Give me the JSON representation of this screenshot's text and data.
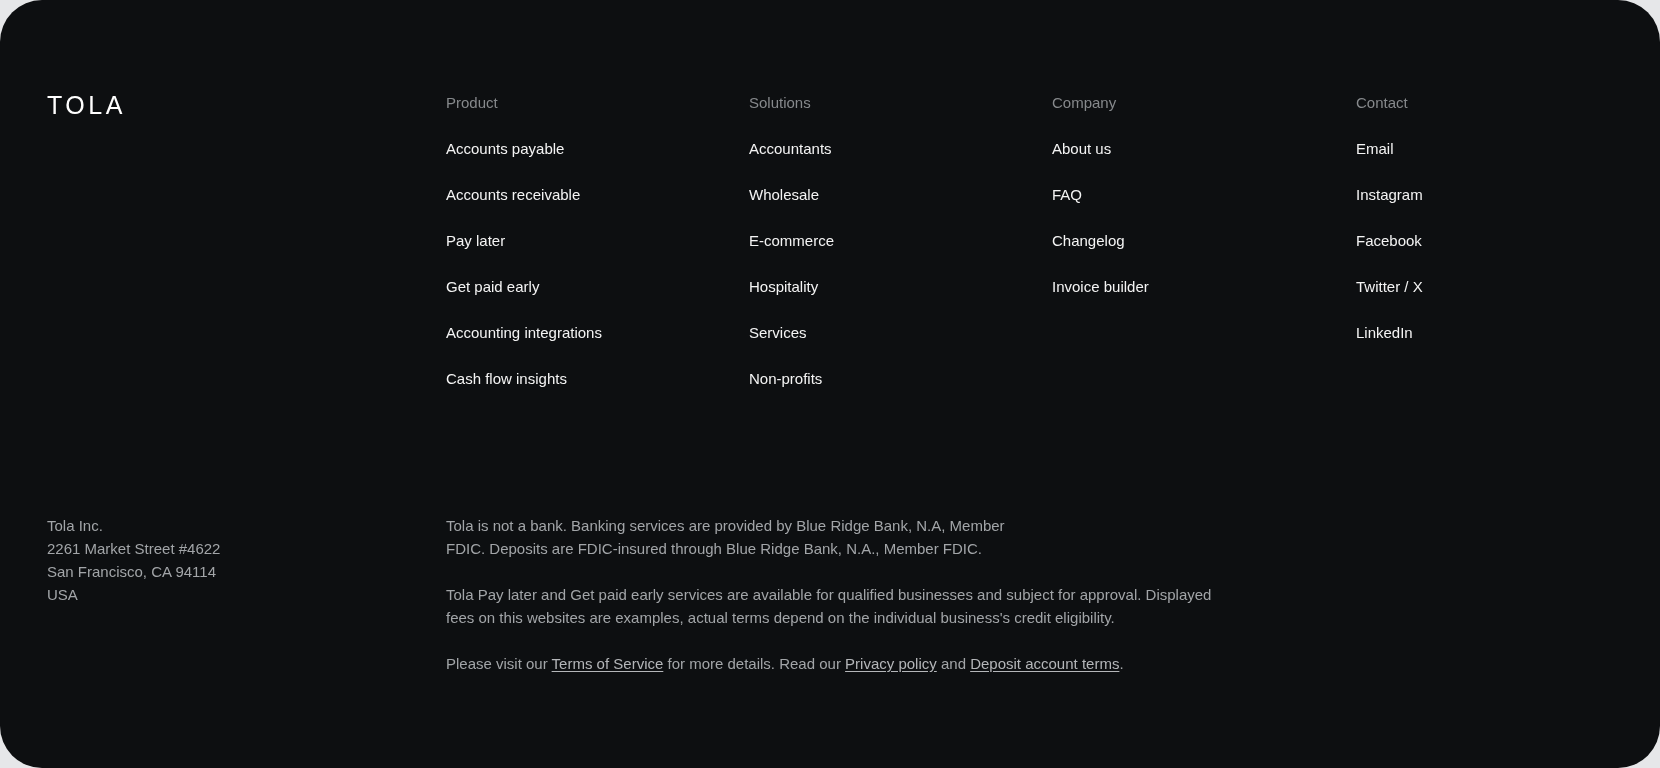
{
  "logo": {
    "text": "TOLA"
  },
  "columns": [
    {
      "heading": "Product",
      "links": [
        "Accounts payable",
        "Accounts receivable",
        "Pay later",
        "Get paid early",
        "Accounting integrations",
        "Cash flow insights"
      ]
    },
    {
      "heading": "Solutions",
      "links": [
        "Accountants",
        "Wholesale",
        "E-commerce",
        "Hospitality",
        "Services",
        "Non-profits"
      ]
    },
    {
      "heading": "Company",
      "links": [
        "About us",
        "FAQ",
        "Changelog",
        "Invoice builder"
      ]
    },
    {
      "heading": "Contact",
      "links": [
        "Email",
        "Instagram",
        "Facebook",
        "Twitter / X",
        "LinkedIn"
      ]
    }
  ],
  "address": {
    "lines": [
      "Tola Inc.",
      "2261 Market Street #4622",
      "San Francisco, CA 94114",
      "USA"
    ]
  },
  "legal": {
    "paragraphs": [
      {
        "kind": "narrow",
        "parts": [
          {
            "kind": "text",
            "text": "Tola is not a bank. Banking services are provided by Blue Ridge Bank, N.A, Member FDIC. Deposits are FDIC-insured through Blue Ridge Bank, N.A., Member FDIC."
          }
        ]
      },
      {
        "kind": "wide",
        "parts": [
          {
            "kind": "text",
            "text": "Tola Pay later and Get paid early services are available for qualified businesses and subject for approval. Displayed fees on this websites are examples, actual terms depend on the individual business's credit eligibility."
          }
        ]
      },
      {
        "kind": "wide",
        "parts": [
          {
            "kind": "text",
            "text": "Please visit our "
          },
          {
            "kind": "link",
            "text": "Terms of Service"
          },
          {
            "kind": "text",
            "text": " for more details. Read our "
          },
          {
            "kind": "link",
            "text": "Privacy policy"
          },
          {
            "kind": "text",
            "text": " and "
          },
          {
            "kind": "link",
            "text": "Deposit account terms"
          },
          {
            "kind": "text",
            "text": "."
          }
        ]
      }
    ]
  }
}
